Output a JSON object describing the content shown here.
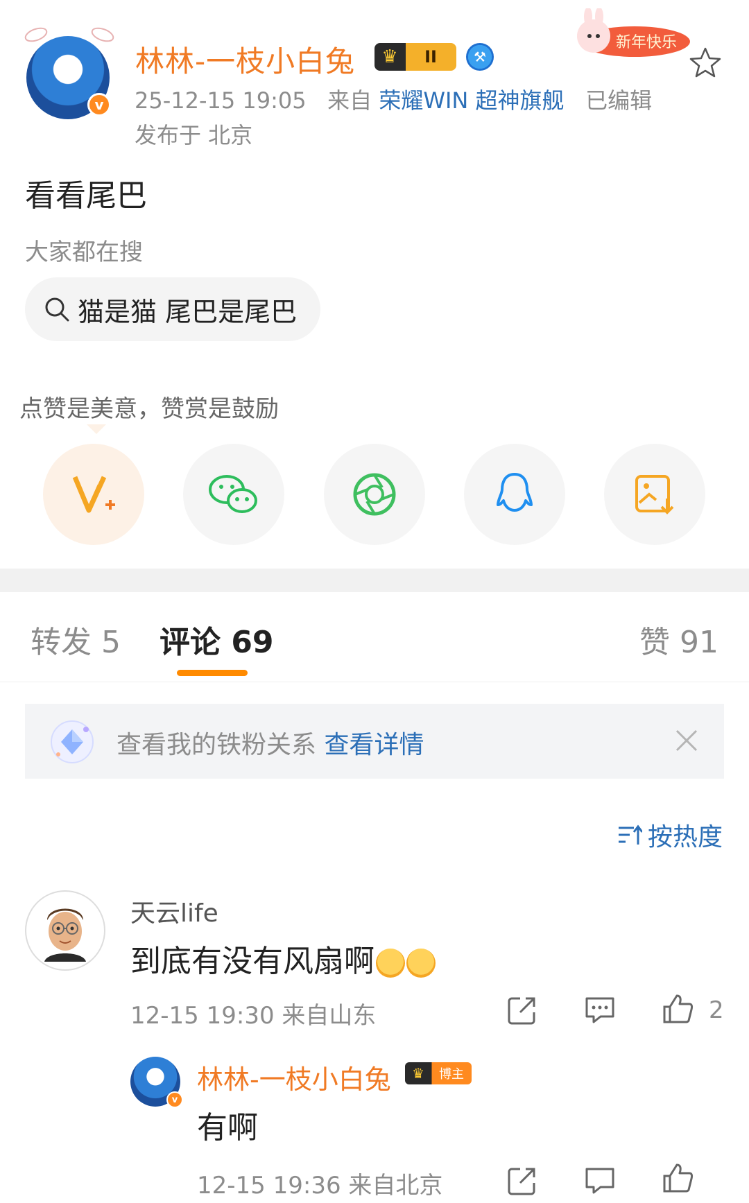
{
  "post": {
    "author": "林林-一枝小白兔",
    "level_badge": "II",
    "time": "25-12-15 19:05",
    "source_prefix": "来自",
    "device": "荣耀WIN 超神旗舰",
    "edited": "已编辑",
    "location": "发布于 北京",
    "text": "看看尾巴",
    "new_year_badge_text": "新年快乐",
    "avatar_badge": "v"
  },
  "search": {
    "hint": "大家都在搜",
    "keyword": "猫是猫 尾巴是尾巴"
  },
  "reward": {
    "text": "点赞是美意，赞赏是鼓励"
  },
  "share_buttons": [
    {
      "icon": "vplus-icon"
    },
    {
      "icon": "wechat-icon"
    },
    {
      "icon": "moments-icon"
    },
    {
      "icon": "qq-icon"
    },
    {
      "icon": "save-image-icon"
    }
  ],
  "tabs": {
    "repost": "转发 5",
    "comments": "评论 69",
    "likes": "赞 91"
  },
  "fan_banner": {
    "text": "查看我的铁粉关系",
    "link": "查看详情"
  },
  "sort": {
    "label": "按热度"
  },
  "comments": [
    {
      "user": "天云life",
      "text": "到底有没有风扇啊",
      "time": "12-15 19:30",
      "location": "来自山东",
      "likes": "2",
      "reply": {
        "user": "林林-一枝小白兔",
        "tag": "博主",
        "text": "有啊",
        "time": "12-15 19:36",
        "location": "来自北京"
      }
    }
  ],
  "colors": {
    "accent_orange": "#f07a24",
    "link_blue": "#2c6fb7",
    "tab_underline": "#ff8a00",
    "meta_gray": "#8c8c8c"
  }
}
